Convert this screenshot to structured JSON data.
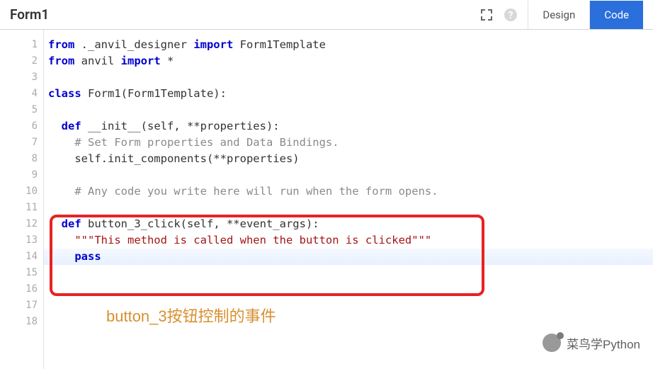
{
  "header": {
    "title": "Form1",
    "tabs": {
      "design": "Design",
      "code": "Code"
    }
  },
  "gutter": {
    "lines": [
      "1",
      "2",
      "3",
      "4",
      "5",
      "6",
      "7",
      "8",
      "9",
      "10",
      "11",
      "12",
      "13",
      "14",
      "15",
      "16",
      "17",
      "18"
    ]
  },
  "code": {
    "l1": {
      "kw1": "from",
      "mod": " ._anvil_designer ",
      "kw2": "import",
      "name": " Form1Template"
    },
    "l2": {
      "kw1": "from",
      "mod": " anvil ",
      "kw2": "import",
      "name": " *"
    },
    "l4": {
      "kw": "class",
      "rest": " Form1(Form1Template):"
    },
    "l6": {
      "indent": "  ",
      "kw": "def",
      "fn": " __init__",
      "sig": "(self, **properties):"
    },
    "l7": "    # Set Form properties and Data Bindings.",
    "l8": "    self.init_components(**properties)",
    "l10": "    # Any code you write here will run when the form opens.",
    "l12": {
      "indent": "  ",
      "kw": "def",
      "fn": " button_3_click",
      "sig": "(self, **event_args):"
    },
    "l13": "    \"\"\"This method is called when the button is clicked\"\"\"",
    "l14": {
      "indent": "    ",
      "kw": "pass"
    }
  },
  "annotation": "button_3按钮控制的事件",
  "watermark": "菜鸟学Python"
}
